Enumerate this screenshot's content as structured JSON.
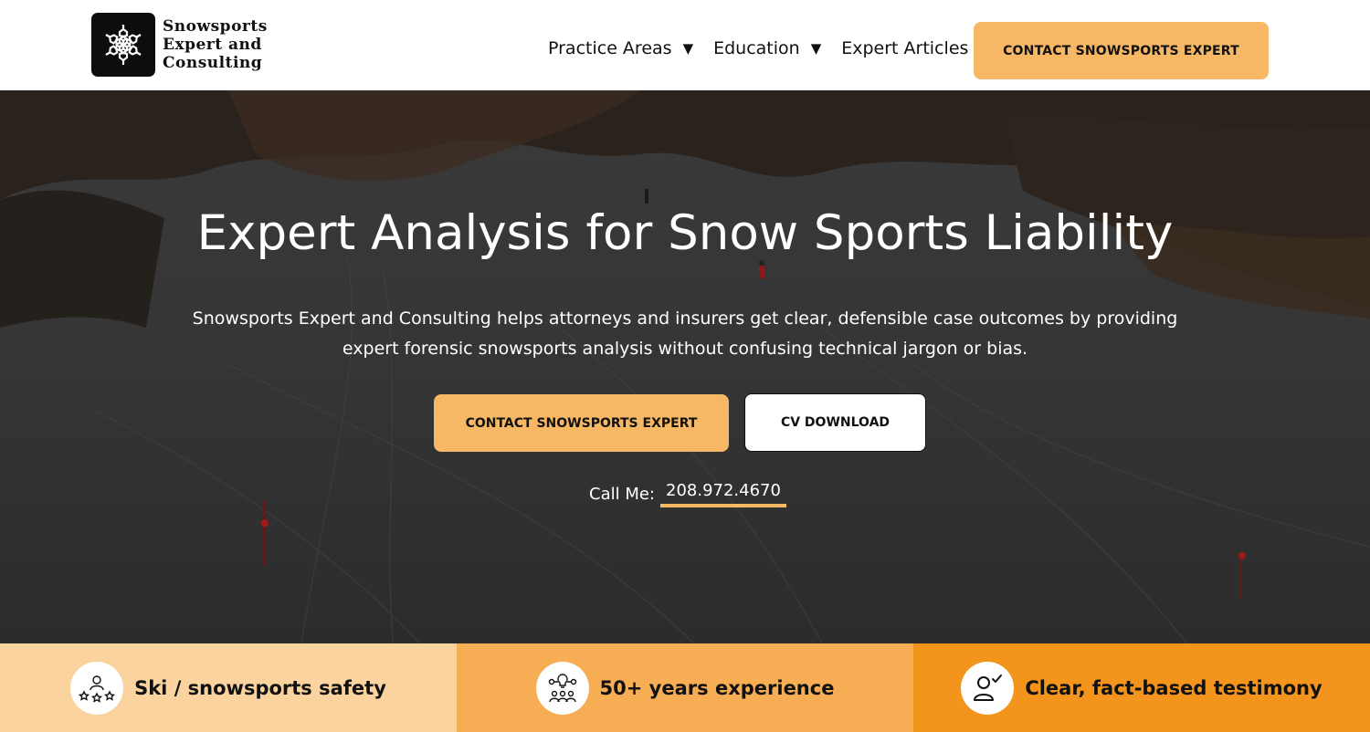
{
  "brand": {
    "name_lines": [
      "Snowsports",
      "Expert and",
      "Consulting"
    ],
    "logo_icon": "snowflake-icon"
  },
  "nav": {
    "items": [
      {
        "label": "Practice Areas",
        "has_dropdown": true
      },
      {
        "label": "Education",
        "has_dropdown": true
      },
      {
        "label": "Expert Articles",
        "has_dropdown": false
      }
    ],
    "dropdown_glyph": "▼",
    "cta_label": "CONTACT SNOWSPORTS EXPERT"
  },
  "hero": {
    "title": "Expert Analysis for Snow Sports Liability",
    "subtitle": "Snowsports Expert and Consulting helps attorneys and insurers get clear, defensible case outcomes by providing expert forensic snowsports analysis without confusing technical jargon or bias.",
    "primary_button": "CONTACT SNOWSPORTS EXPERT",
    "secondary_button": "CV DOWNLOAD",
    "call_label": "Call Me:",
    "phone": "208.972.4670"
  },
  "features": [
    {
      "label": "Ski / snowsports safety",
      "icon": "group-stars-icon"
    },
    {
      "label": "50+ years experience",
      "icon": "team-lightbulb-icon"
    },
    {
      "label": "Clear, fact-based testimony",
      "icon": "person-check-icon"
    }
  ],
  "colors": {
    "accent": "#f7b866",
    "feature_1": "#fad39e",
    "feature_2": "#f6ad54",
    "feature_3": "#f3941c",
    "logo_bg": "#0d0d0d"
  }
}
